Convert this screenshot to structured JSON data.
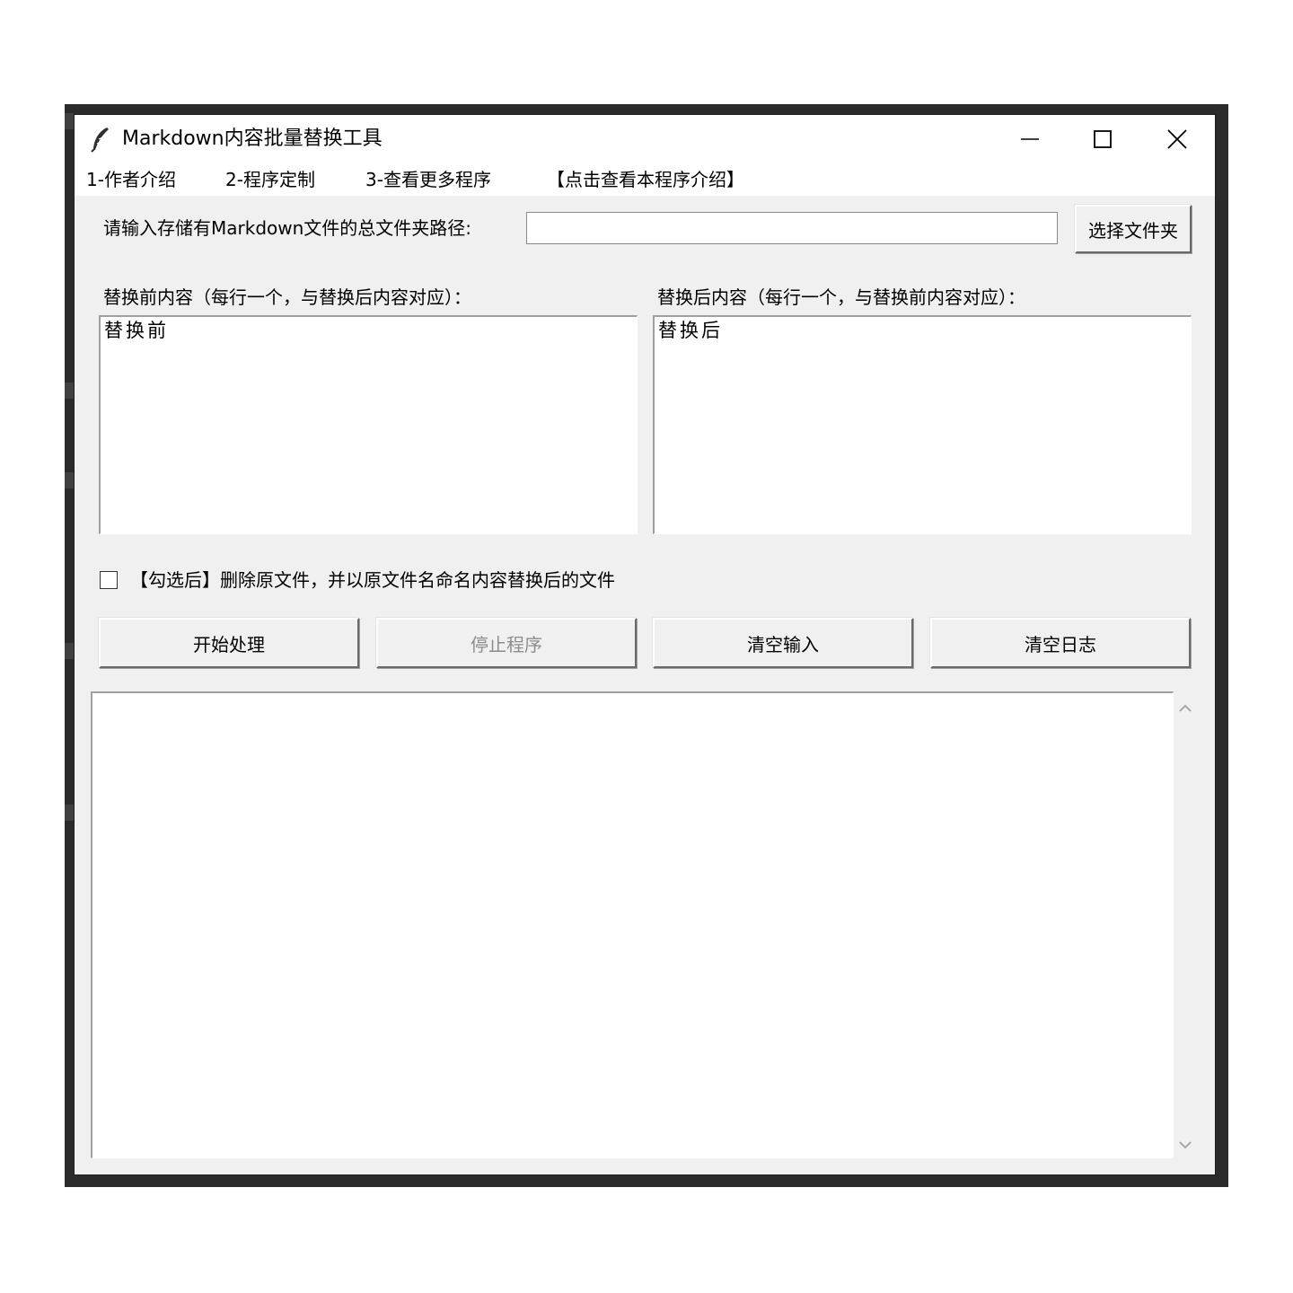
{
  "window": {
    "title": "Markdown内容批量替换工具",
    "icon": "feather-icon"
  },
  "menu": {
    "items": [
      {
        "label": "1-作者介绍"
      },
      {
        "label": "2-程序定制"
      },
      {
        "label": "3-查看更多程序"
      },
      {
        "label": "【点击查看本程序介绍】"
      }
    ]
  },
  "folder": {
    "label": "请输入存储有Markdown文件的总文件夹路径:",
    "value": "",
    "browse_label": "选择文件夹"
  },
  "before": {
    "label": "替换前内容（每行一个，与替换后内容对应）：",
    "value": "替换前"
  },
  "after": {
    "label": "替换后内容（每行一个，与替换前内容对应）：",
    "value": "替换后"
  },
  "option": {
    "checked": false,
    "label": "【勾选后】删除原文件，并以原文件名命名内容替换后的文件"
  },
  "actions": {
    "start": "开始处理",
    "stop": "停止程序",
    "clear_input": "清空输入",
    "clear_log": "清空日志"
  },
  "log": {
    "value": ""
  }
}
